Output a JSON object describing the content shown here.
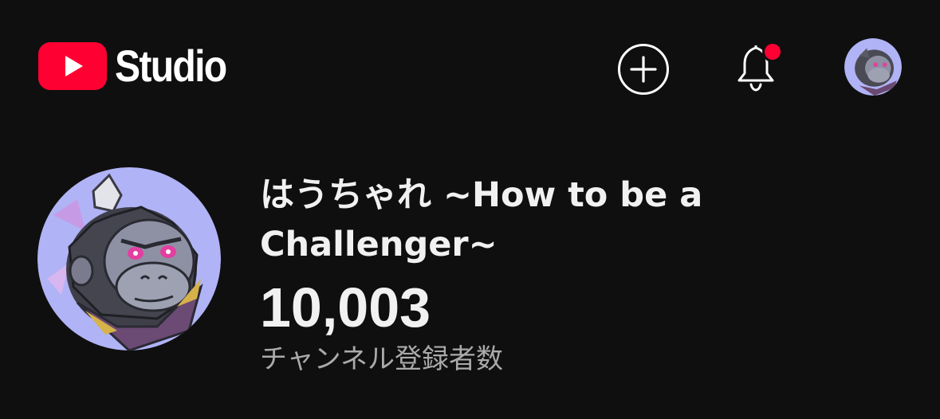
{
  "header": {
    "app_name": "Studio",
    "brand_color": "#ff0033",
    "notification_dot_color": "#ff0033",
    "icons": {
      "create": "plus-circle-icon",
      "notifications": "bell-icon",
      "account": "avatar"
    }
  },
  "channel": {
    "name": "はうちゃれ ~How to be a Challenger~",
    "subscriber_count": "10,003",
    "subscriber_label": "チャンネル登録者数",
    "avatar_background": "#b0b3f5"
  }
}
